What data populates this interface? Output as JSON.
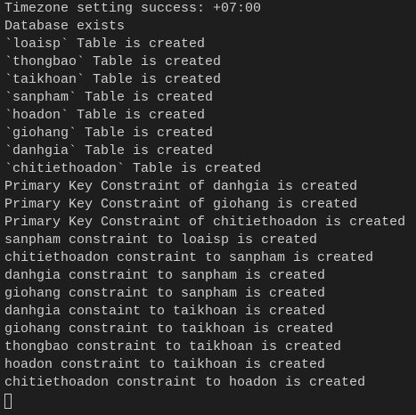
{
  "colors": {
    "background": "#1e1e1e",
    "text": "#cccccc"
  },
  "lines": [
    "Timezone setting success: +07:00",
    "Database exists",
    "`loaisp` Table is created",
    "`thongbao` Table is created",
    "`taikhoan` Table is created",
    "`sanpham` Table is created",
    "`hoadon` Table is created",
    "`giohang` Table is created",
    "`danhgia` Table is created",
    "`chitiethoadon` Table is created",
    "Primary Key Constraint of danhgia is created",
    "Primary Key Constraint of giohang is created",
    "Primary Key Constraint of chitiethoadon is created",
    "sanpham constraint to loaisp is created",
    "chitiethoadon constraint to sanpham is created",
    "danhgia constraint to sanpham is created",
    "giohang constraint to sanpham is created",
    "danhgia constaint to taikhoan is created",
    "giohang constraint to taikhoan is created",
    "thongbao constraint to taikhoan is created",
    "hoadon constraint to taikhoan is created",
    "chitiethoadon constraint to hoadon is created"
  ]
}
